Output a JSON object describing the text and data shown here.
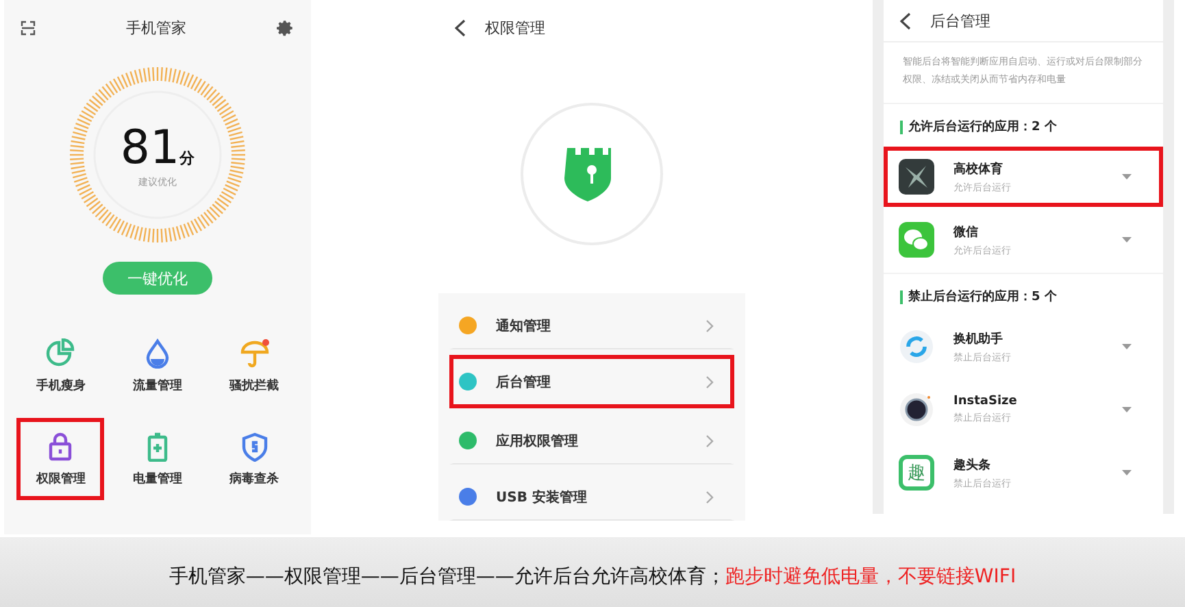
{
  "screens": [
    {
      "kind": "home",
      "title": "手机管家",
      "score": "81",
      "score_unit": "分",
      "score_hint": "建议优化",
      "action": "一键优化",
      "tools": [
        {
          "label": "手机瘦身",
          "kind": "pie",
          "color": "#3dbb8a",
          "badge": false,
          "highlighted": false
        },
        {
          "label": "流量管理",
          "kind": "drop",
          "color": "#4a7ee8",
          "badge": false,
          "highlighted": false
        },
        {
          "label": "骚扰拦截",
          "kind": "umbrella",
          "color": "#f0a820",
          "badge": true,
          "highlighted": false
        },
        {
          "label": "权限管理",
          "kind": "lock",
          "color": "#8a4fd8",
          "badge": false,
          "highlighted": true
        },
        {
          "label": "电量管理",
          "kind": "battery",
          "color": "#3dbb8a",
          "badge": false,
          "highlighted": false
        },
        {
          "label": "病毒查杀",
          "kind": "shield",
          "color": "#4a7ee8",
          "badge": false,
          "highlighted": false
        }
      ]
    },
    {
      "kind": "permissions",
      "title": "权限管理",
      "items": [
        {
          "label": "通知管理",
          "color": "#f5a623",
          "highlighted": false
        },
        {
          "label": "后台管理",
          "color": "#2ec4c4",
          "highlighted": true
        },
        {
          "label": "应用权限管理",
          "color": "#2dbb6a",
          "highlighted": false
        },
        {
          "label": "USB 安装管理",
          "color": "#4a7ee8",
          "highlighted": false
        }
      ]
    },
    {
      "kind": "background",
      "title": "后台管理",
      "description": "智能后台将智能判断应用自启动、运行或对后台限制部分权限、冻结或关闭从而节省内存和电量",
      "sections": [
        {
          "heading": "允许后台运行的应用：2 个",
          "apps": [
            {
              "name": "高校体育",
              "status": "允许后台运行",
              "kind": "star",
              "highlighted": true
            },
            {
              "name": "微信",
              "status": "允许后台运行",
              "kind": "chat",
              "highlighted": false
            }
          ]
        },
        {
          "heading": "禁止后台运行的应用：5 个",
          "apps": [
            {
              "name": "换机助手",
              "status": "禁止后台运行",
              "kind": "ring",
              "highlighted": false
            },
            {
              "name": "InstaSize",
              "status": "禁止后台运行",
              "kind": "lens",
              "highlighted": false
            },
            {
              "name": "趣头条",
              "status": "禁止后台运行",
              "kind": "glyph",
              "logo_text": "趣",
              "highlighted": false
            }
          ]
        }
      ]
    }
  ],
  "caption": {
    "path": "手机管家——权限管理——后台管理——允许后台允许高校体育；",
    "note": "跑步时避免低电量，不要链接WIFI"
  }
}
